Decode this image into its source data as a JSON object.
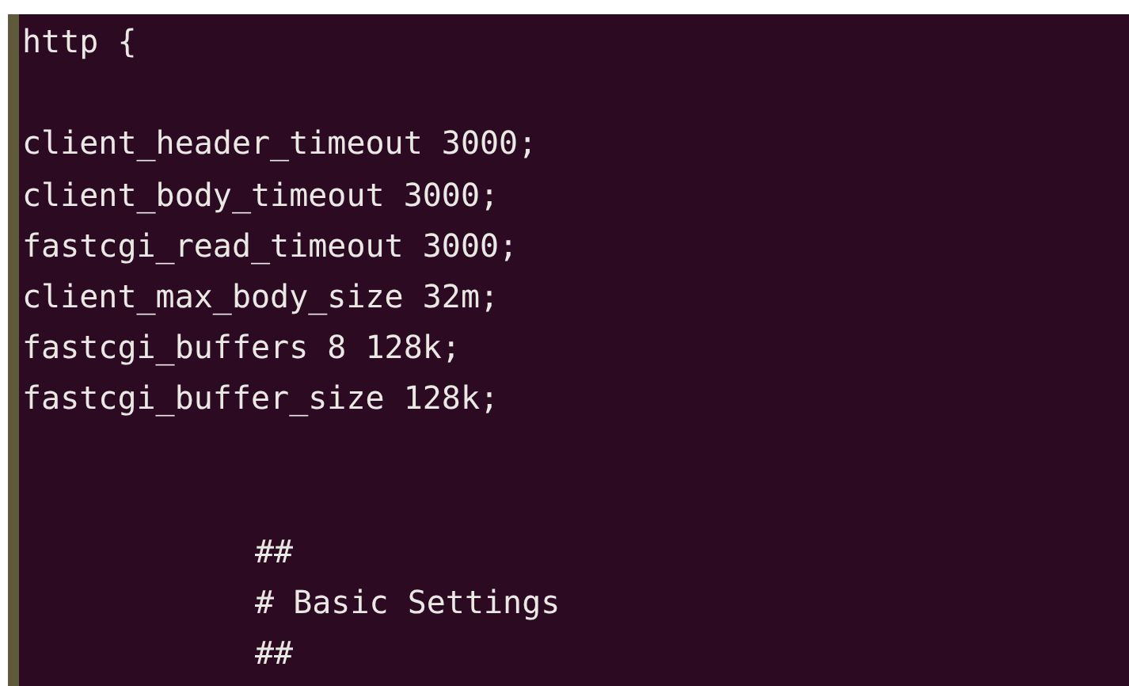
{
  "terminal": {
    "lines": [
      {
        "kind": "plain",
        "text": "http {"
      },
      {
        "kind": "blank"
      },
      {
        "kind": "plain",
        "text": "client_header_timeout 3000;"
      },
      {
        "kind": "plain",
        "text": "client_body_timeout 3000;"
      },
      {
        "kind": "plain",
        "text": "fastcgi_read_timeout 3000;"
      },
      {
        "kind": "plain",
        "text": "client_max_body_size 32m;"
      },
      {
        "kind": "plain",
        "text": "fastcgi_buffers 8 128k;"
      },
      {
        "kind": "plain",
        "text": "fastcgi_buffer_size 128k;"
      },
      {
        "kind": "blank"
      },
      {
        "kind": "blank"
      },
      {
        "kind": "indented",
        "text": "##"
      },
      {
        "kind": "indented",
        "text": "# Basic Settings"
      },
      {
        "kind": "indented",
        "text": "##"
      }
    ]
  }
}
